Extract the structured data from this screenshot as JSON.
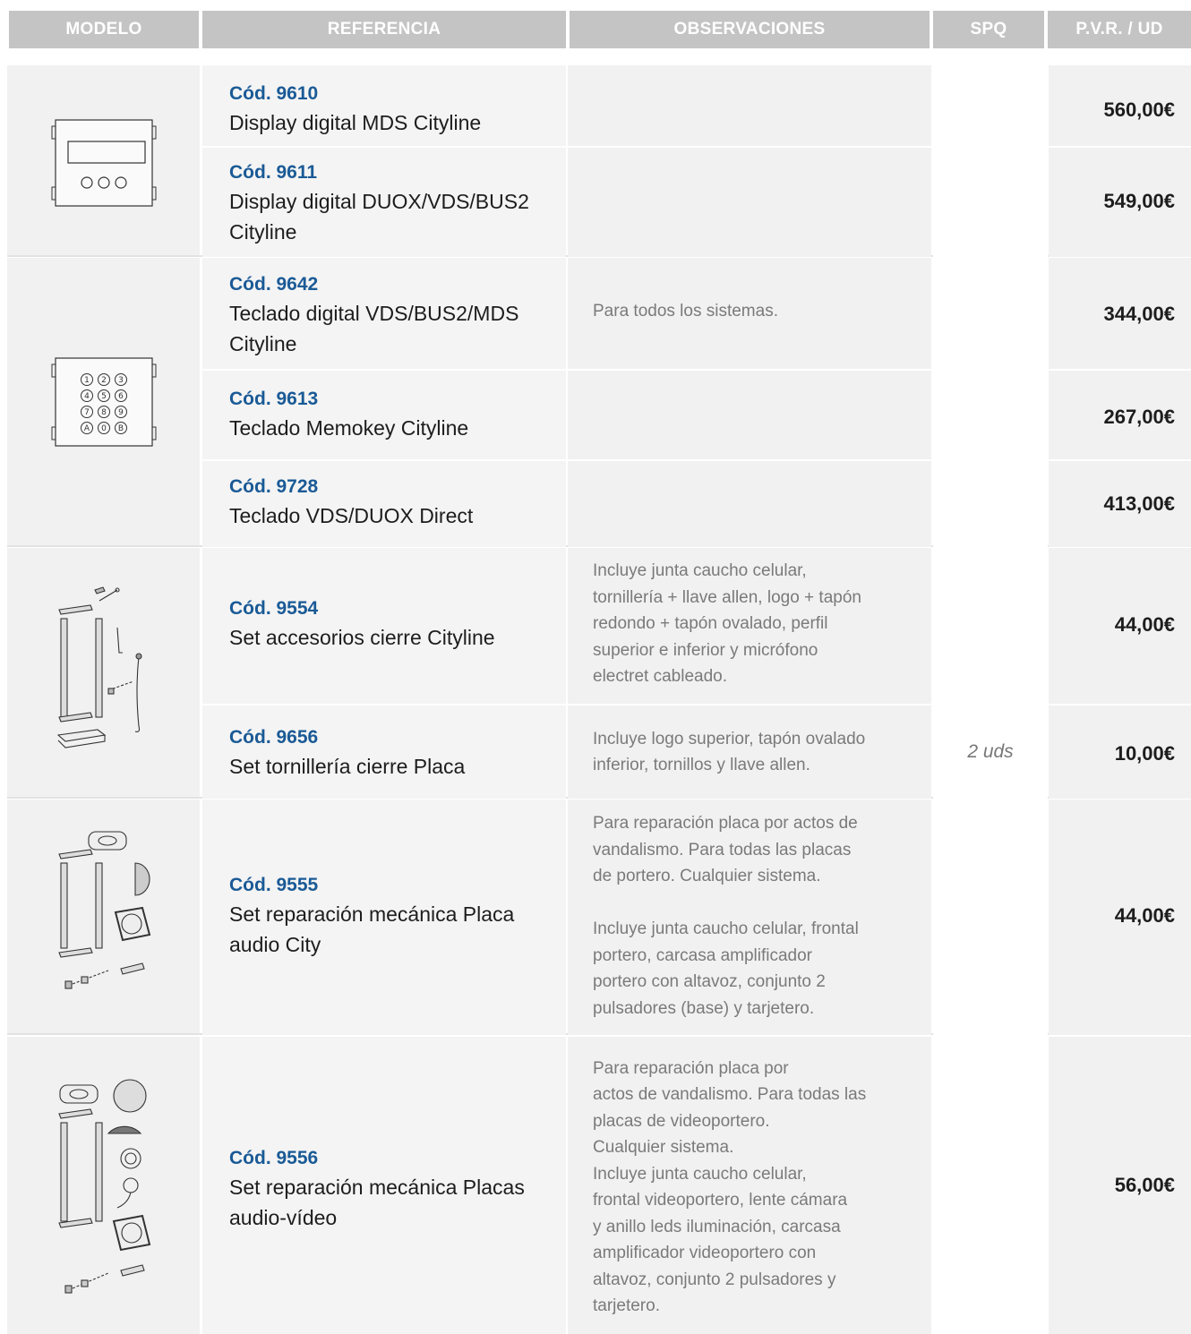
{
  "header": {
    "modelo": "MODELO",
    "referencia": "REFERENCIA",
    "observaciones": "OBSERVACIONES",
    "spq": "SPQ",
    "pvr": "P.V.R. / UD"
  },
  "groups": [
    {
      "model_icon": "display-panel-icon",
      "observation": "",
      "rows": [
        {
          "code": "Cód. 9610",
          "name": "Display digital MDS Cityline",
          "spq": "",
          "price": "560,00€"
        },
        {
          "code": "Cód. 9611",
          "name": "Display digital DUOX/VDS/BUS2 Cityline",
          "spq": "",
          "price": "549,00€"
        }
      ]
    },
    {
      "model_icon": "keypad-panel-icon",
      "observation": "Para todos los sistemas.",
      "rows": [
        {
          "code": "Cód. 9642",
          "name": "Teclado digital VDS/BUS2/MDS Cityline",
          "spq": "",
          "price": "344,00€"
        },
        {
          "code": "Cód. 9613",
          "name": "Teclado Memokey Cityline",
          "spq": "",
          "price": "267,00€"
        },
        {
          "code": "Cód. 9728",
          "name": "Teclado VDS/DUOX Direct",
          "spq": "",
          "price": "413,00€"
        }
      ]
    },
    {
      "model_icon": "closure-accessories-kit-icon",
      "rows": [
        {
          "code": "Cód. 9554",
          "name": "Set accesorios cierre Cityline",
          "observation": "Incluye junta caucho celular,\ntornillería + llave allen, logo + tapón\nredondo + tapón ovalado, perfil\nsuperior e inferior y micrófono\nelectret cableado.",
          "spq": "",
          "price": "44,00€"
        },
        {
          "code": "Cód. 9656",
          "name": "Set tornillería cierre Placa",
          "observation": "Incluye logo superior, tapón ovalado\ninferior, tornillos y llave allen.",
          "spq": "2 uds",
          "price": "10,00€"
        }
      ]
    },
    {
      "model_icon": "audio-repair-kit-icon",
      "rows": [
        {
          "code": "Cód. 9555",
          "name": "Set reparación mecánica Placa audio City",
          "observation": "Para reparación placa por actos de\nvandalismo. Para todas las placas\nde portero. Cualquier sistema.\n\nIncluye junta caucho celular, frontal\nportero, carcasa amplificador\nportero con altavoz, conjunto 2\npulsadores (base) y tarjetero.",
          "spq": "",
          "price": "44,00€"
        }
      ]
    },
    {
      "model_icon": "video-repair-kit-icon",
      "rows": [
        {
          "code": "Cód. 9556",
          "name": "Set reparación mecánica Placas audio-vídeo",
          "observation": "Para reparación placa por\nactos de vandalismo. Para todas las\nplacas de videoportero.\nCualquier sistema.\nIncluye junta caucho celular,\nfrontal videoportero, lente cámara\ny anillo leds iluminación, carcasa\namplificador videoportero con\naltavoz, conjunto 2 pulsadores y\ntarjetero.",
          "spq": "",
          "price": "56,00€"
        }
      ]
    }
  ]
}
